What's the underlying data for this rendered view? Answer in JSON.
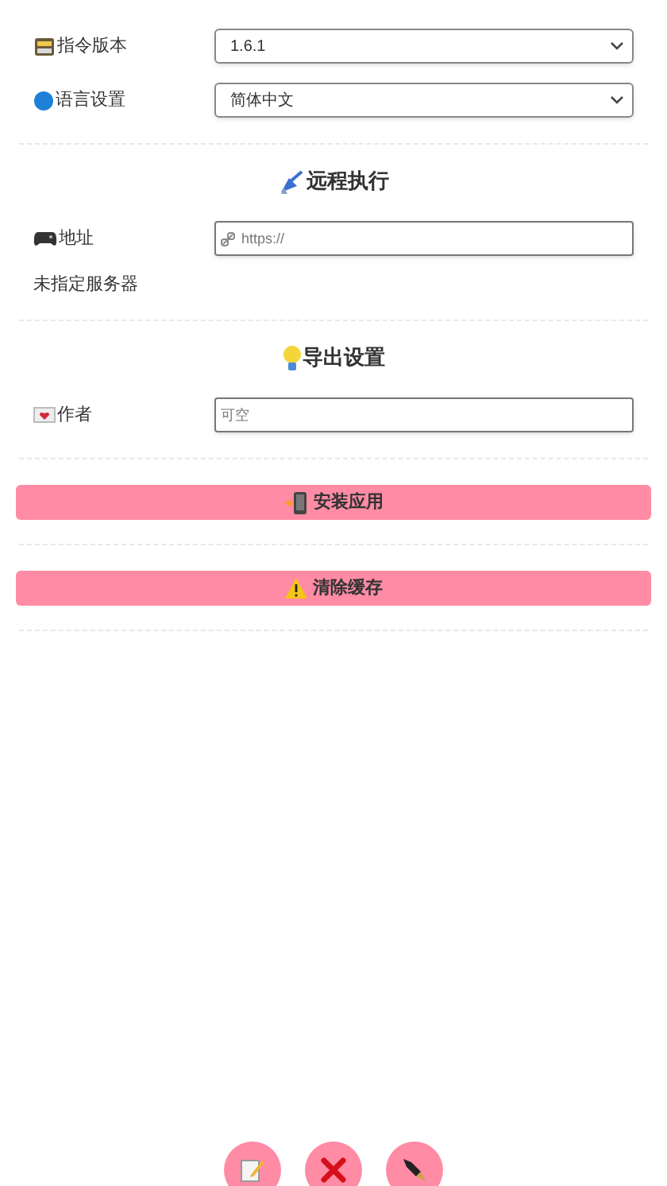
{
  "settings": [
    {
      "label": "指令版本",
      "kind": "select",
      "value": "1.6.1"
    },
    {
      "label": "语言设置",
      "kind": "select",
      "value": "简体中文"
    }
  ],
  "sections": [
    {
      "title": "远程执行",
      "fields": [
        {
          "label": "地址",
          "placeholder": "https://"
        }
      ],
      "note": "未指定服务器"
    },
    {
      "title": "导出设置",
      "fields": [
        {
          "label": "作者",
          "placeholder": "可空"
        }
      ]
    }
  ],
  "actions": [
    {
      "label": "安装应用"
    },
    {
      "label": "清除缓存"
    }
  ]
}
